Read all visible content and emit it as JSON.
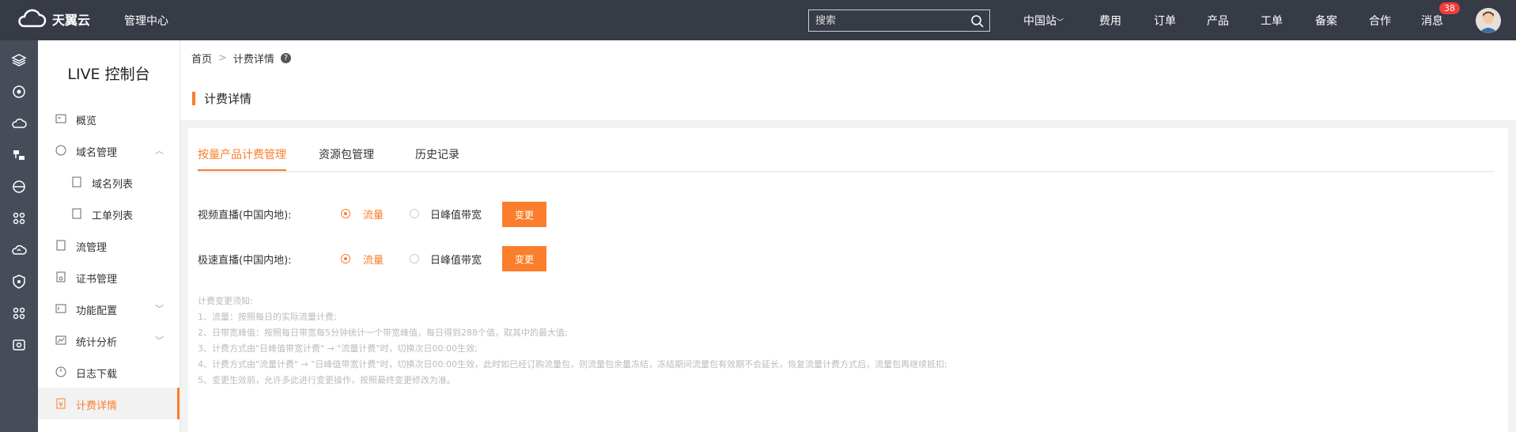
{
  "header": {
    "brand": "天翼云",
    "console": "管理中心",
    "search_placeholder": "搜索",
    "nav": [
      "中国站",
      "费用",
      "订单",
      "产品",
      "工单",
      "备案",
      "合作",
      "消息"
    ],
    "badge": "38"
  },
  "rail_icons": [
    "layers-icon",
    "settings-circle-icon",
    "cloud-icon",
    "database-icon",
    "globe-icon",
    "nodes-icon",
    "cloud-refresh-icon",
    "shield-icon",
    "nodes2-icon",
    "storage-icon"
  ],
  "sidebar": {
    "title": "LIVE 控制台",
    "items": [
      {
        "label": "概览"
      },
      {
        "label": "域名管理"
      },
      {
        "label": "域名列表"
      },
      {
        "label": "工单列表"
      },
      {
        "label": "流管理"
      },
      {
        "label": "证书管理"
      },
      {
        "label": "功能配置"
      },
      {
        "label": "统计分析"
      },
      {
        "label": "日志下载"
      },
      {
        "label": "计费详情"
      }
    ]
  },
  "breadcrumb": {
    "home": "首页",
    "current": "计费详情"
  },
  "page_title": "计费详情",
  "tabs": [
    "按量产品计费管理",
    "资源包管理",
    "历史记录"
  ],
  "billing_rows": [
    {
      "label": "视频直播(中国内地):",
      "opt1": "流量",
      "opt2": "日峰值带宽",
      "button": "变更"
    },
    {
      "label": "极速直播(中国内地):",
      "opt1": "流量",
      "opt2": "日峰值带宽",
      "button": "变更"
    }
  ],
  "notes": [
    "计费变更须知:",
    "1、流量：按照每日的实际流量计费;",
    "2、日带宽峰值：按照每日带宽每5分钟统计一个带宽峰值，每日得到288个值，取其中的最大值;",
    "3、计费方式由\"日峰值带宽计费\" → \"流量计费\"时，切换次日00:00生效;",
    "4、计费方式由\"流量计费\" → \"日峰值带宽计费\"时，切换次日00:00生效，此时如已经订购流量包，则流量包余量冻结，冻结期间流量包有效期不会延长，恢复流量计费方式后，流量包再继续抵扣;",
    "5、变更生效前，允许多此进行变更操作，按照最终变更修改为准。"
  ],
  "colors": {
    "accent": "#fa7e2b",
    "topbar": "#363b46",
    "rail": "#474c59"
  }
}
